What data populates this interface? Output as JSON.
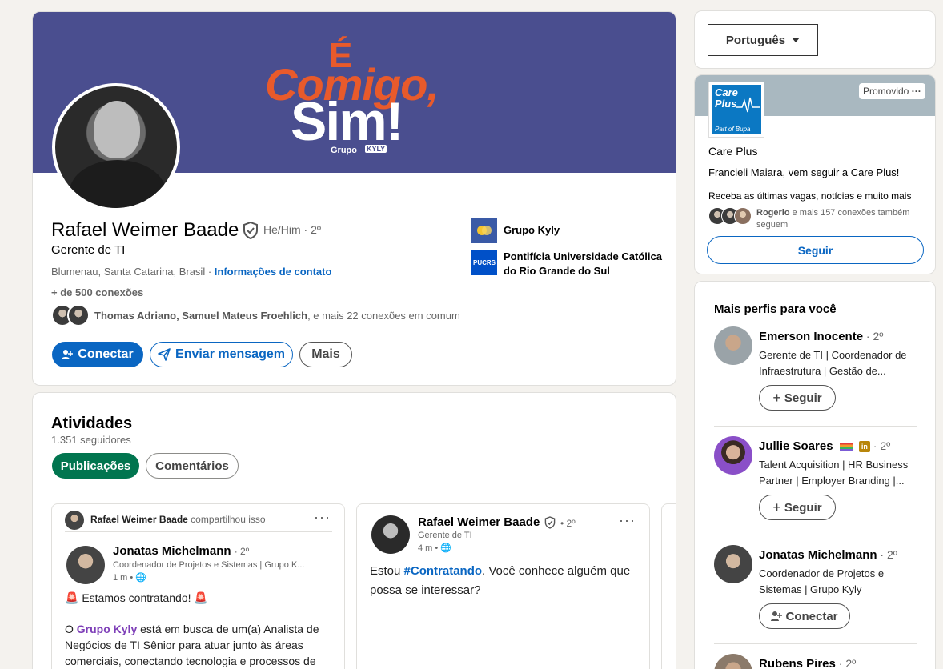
{
  "profile": {
    "banner": {
      "line1": "É",
      "line2": "Comigo,",
      "line3": "Sim!",
      "brand_group": "Grupo",
      "brand_name": "KYLY"
    },
    "name": "Rafael Weimer Baade",
    "pronouns_degree": "He/Him · 2º",
    "headline": "Gerente de TI",
    "location": "Blumenau, Santa Catarina, Brasil · ",
    "contact_info": "Informações de contato",
    "connections": "+ de 500 conexões",
    "mutual_names": "Thomas Adriano, Samuel Mateus Froehlich",
    "mutual_rest": ", e mais 22 conexões em comum",
    "buttons": {
      "connect": "Conectar",
      "message": "Enviar mensagem",
      "more": "Mais"
    },
    "orgs": [
      {
        "name": "Grupo Kyly",
        "logo_text": ""
      },
      {
        "name": "Pontifícia Universidade Católica do Rio Grande do Sul",
        "logo_text": "PUCRS"
      }
    ]
  },
  "activity": {
    "title": "Atividades",
    "followers": "1.351 seguidores",
    "tabs": [
      "Publicações",
      "Comentários"
    ],
    "post1": {
      "reshared_by": "Rafael Weimer Baade",
      "reshared_label": " compartilhou isso",
      "author": "Jonatas Michelmann",
      "degree": "· 2º",
      "headline": "Coordenador de Projetos e Sistemas | Grupo K...",
      "time": "1 m • ",
      "line1": "Estamos contratando!",
      "text_pre": "O ",
      "company": "Grupo Kyly",
      "text_post": " está em busca de um(a) Analista de Negócios de TI Sênior para atuar junto às áreas comerciais, conectando tecnologia e processos de"
    },
    "post2": {
      "author": "Rafael Weimer Baade",
      "degree": "• 2º",
      "headline": "Gerente de TI",
      "time": "4 m • ",
      "text_pre": "Estou ",
      "hashtag": "#Contratando",
      "text_post": ". Você conhece alguém que possa se interessar?"
    }
  },
  "sidebar": {
    "language": "Português",
    "ad": {
      "promoted": "Promovido",
      "logo_line1": "Care",
      "logo_line2": "Plus",
      "logo_tag": "Part of Bupa",
      "company": "Care Plus",
      "message": "Francieli Maiara, vem seguir a Care Plus!",
      "subtitle": "Receba as últimas vagas, notícias e muito mais",
      "social_name": "Rogerio",
      "social_rest": " e mais 157 conexões também seguem",
      "follow": "Seguir"
    },
    "people_title": "Mais perfis para você",
    "people": [
      {
        "name": "Emerson Inocente",
        "degree": " · 2º",
        "headline": "Gerente de TI | Coordenador de Infraestrutura | Gestão de...",
        "action": "Seguir"
      },
      {
        "name": "Jullie Soares",
        "degree": " · 2º",
        "headline": "Talent Acquisition | HR Business Partner | Employer Branding |...",
        "action": "Seguir"
      },
      {
        "name": "Jonatas Michelmann",
        "degree": " · 2º",
        "headline": "Coordenador de Projetos e Sistemas | Grupo Kyly",
        "action": "Conectar"
      },
      {
        "name": "Rubens Pires",
        "degree": " · 2º",
        "headline": "",
        "action": ""
      }
    ]
  },
  "colors": {
    "linkedin_blue": "#0a66c2",
    "active_green": "#01754f",
    "banner_purple": "#4a4e8f",
    "banner_orange": "#e85a2b"
  }
}
